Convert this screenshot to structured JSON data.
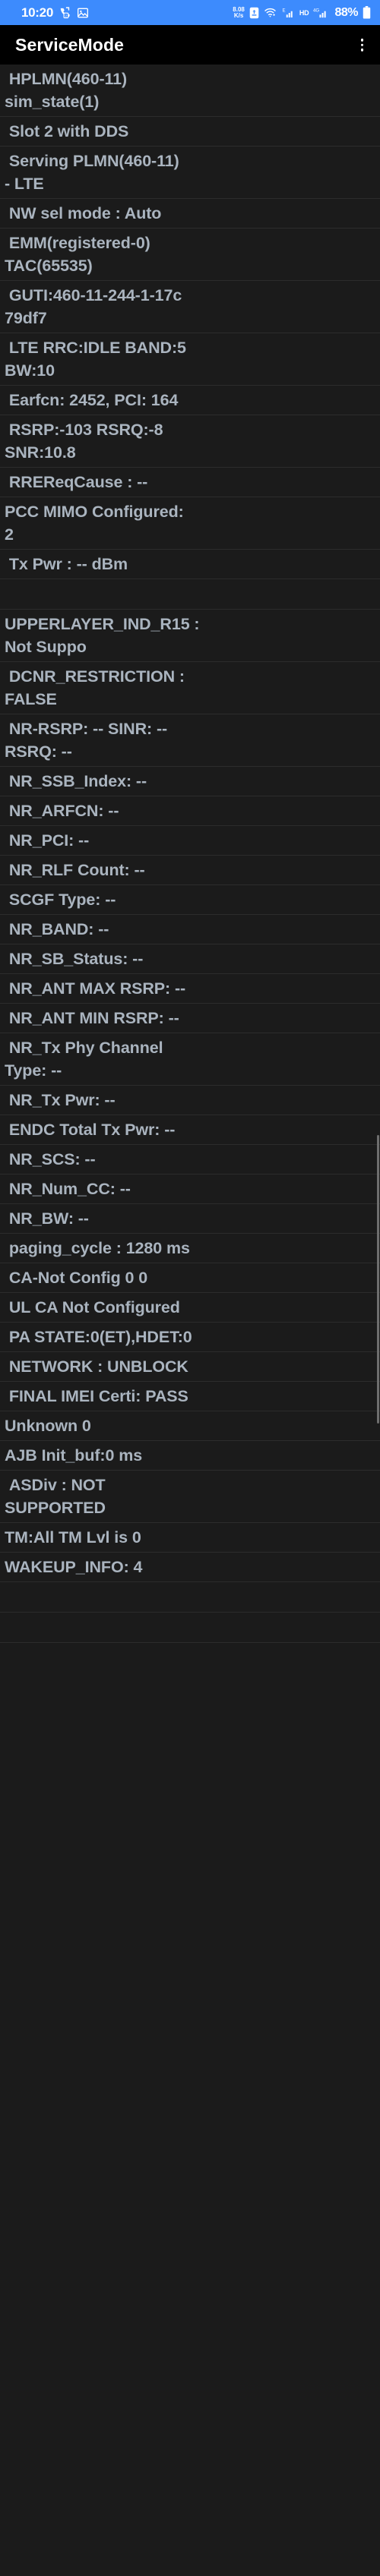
{
  "status_bar": {
    "time": "10:20",
    "net_speed_value": "8.08",
    "net_speed_unit": "K/s",
    "signal_type_1": "E",
    "hd_badge": "HD",
    "signal_type_2": "4G",
    "battery_percent": "88%",
    "icons": [
      "missed-call-sim2-icon",
      "gallery-icon",
      "net-speed-icon",
      "nfc-icon",
      "wifi-icon",
      "signal-e-icon",
      "hd-icon",
      "signal-4g-icon",
      "battery-icon"
    ]
  },
  "app_bar": {
    "title": "ServiceMode",
    "overflow_label": "More options"
  },
  "list": {
    "rows": [
      {
        "text": " HPLMN(460-11)\nsim_state(1)"
      },
      {
        "text": " Slot 2 with DDS"
      },
      {
        "text": " Serving PLMN(460-11)\n- LTE"
      },
      {
        "text": " NW sel mode : Auto"
      },
      {
        "text": " EMM(registered-0)\nTAC(65535)"
      },
      {
        "text": " GUTI:460-11-244-1-17c\n79df7"
      },
      {
        "text": " LTE RRC:IDLE BAND:5\nBW:10"
      },
      {
        "text": " Earfcn: 2452, PCI: 164"
      },
      {
        "text": " RSRP:-103 RSRQ:-8\nSNR:10.8"
      },
      {
        "text": " RREReqCause : --"
      },
      {
        "text": "PCC MIMO Configured:\n2"
      },
      {
        "text": " Tx Pwr : -- dBm"
      },
      {
        "text": ""
      },
      {
        "text": "UPPERLAYER_IND_R15 :\nNot Suppo"
      },
      {
        "text": " DCNR_RESTRICTION :\nFALSE"
      },
      {
        "text": " NR-RSRP: -- SINR: --\nRSRQ: --"
      },
      {
        "text": " NR_SSB_Index: --"
      },
      {
        "text": " NR_ARFCN: --"
      },
      {
        "text": " NR_PCI: --"
      },
      {
        "text": " NR_RLF Count: --"
      },
      {
        "text": " SCGF Type: --"
      },
      {
        "text": " NR_BAND: --"
      },
      {
        "text": " NR_SB_Status: --"
      },
      {
        "text": " NR_ANT MAX RSRP: --"
      },
      {
        "text": " NR_ANT MIN RSRP: --"
      },
      {
        "text": " NR_Tx Phy Channel\nType: --"
      },
      {
        "text": " NR_Tx Pwr: --"
      },
      {
        "text": " ENDC Total Tx Pwr: --"
      },
      {
        "text": " NR_SCS: --"
      },
      {
        "text": " NR_Num_CC: --"
      },
      {
        "text": " NR_BW: --"
      },
      {
        "text": " paging_cycle : 1280 ms"
      },
      {
        "text": " CA-Not Config 0 0"
      },
      {
        "text": " UL CA Not Configured"
      },
      {
        "text": " PA STATE:0(ET),HDET:0"
      },
      {
        "text": " NETWORK : UNBLOCK"
      },
      {
        "text": " FINAL IMEI Certi: PASS"
      },
      {
        "text": "Unknown 0"
      },
      {
        "text": "AJB Init_buf:0 ms"
      },
      {
        "text": " ASDiv : NOT\nSUPPORTED"
      },
      {
        "text": "TM:All TM Lvl is 0"
      },
      {
        "text": "WAKEUP_INFO: 4"
      },
      {
        "text": ""
      },
      {
        "text": ""
      }
    ]
  },
  "colors": {
    "status_bar_bg": "#3d8bfd",
    "app_bar_bg": "#000000",
    "list_bg": "#1b1b1b",
    "text": "#aab4bf",
    "divider": "#2c2c2c",
    "scrollbar": "#6e6e6e"
  }
}
